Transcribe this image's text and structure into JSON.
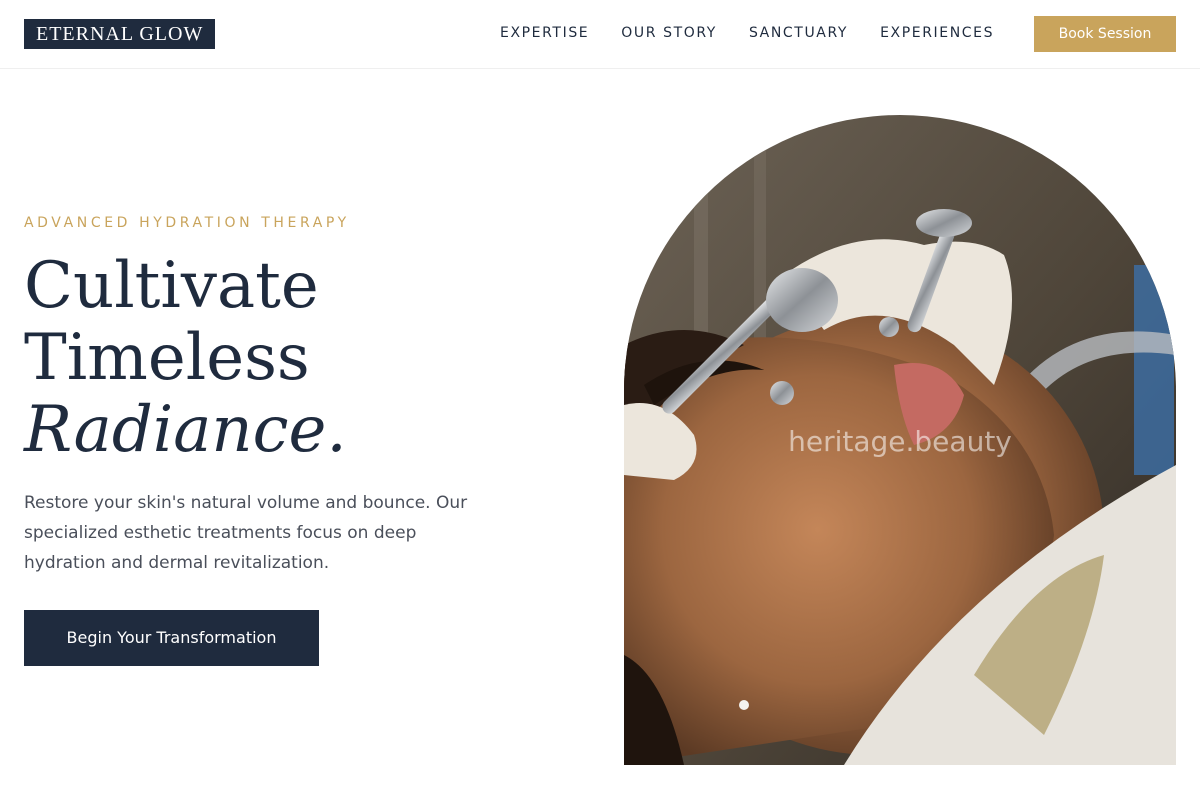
{
  "header": {
    "logo": "ETERNAL GLOW",
    "nav": [
      "EXPERTISE",
      "OUR STORY",
      "SANCTUARY",
      "EXPERIENCES"
    ],
    "book_label": "Book Session"
  },
  "hero": {
    "eyebrow": "ADVANCED HYDRATION THERAPY",
    "headline": [
      "Cultivate",
      "Timeless",
      "Radiance."
    ],
    "body": "Restore your skin's natural volume and bounce. Our specialized esthetic treatments focus on deep hydration and dermal revitalization.",
    "cta_label": "Begin Your Transformation",
    "image": {
      "watermark": "heritage.beauty"
    }
  },
  "colors": {
    "navy": "#1f2b3e",
    "gold": "#c9a45c",
    "text": "#4a4f5a"
  }
}
